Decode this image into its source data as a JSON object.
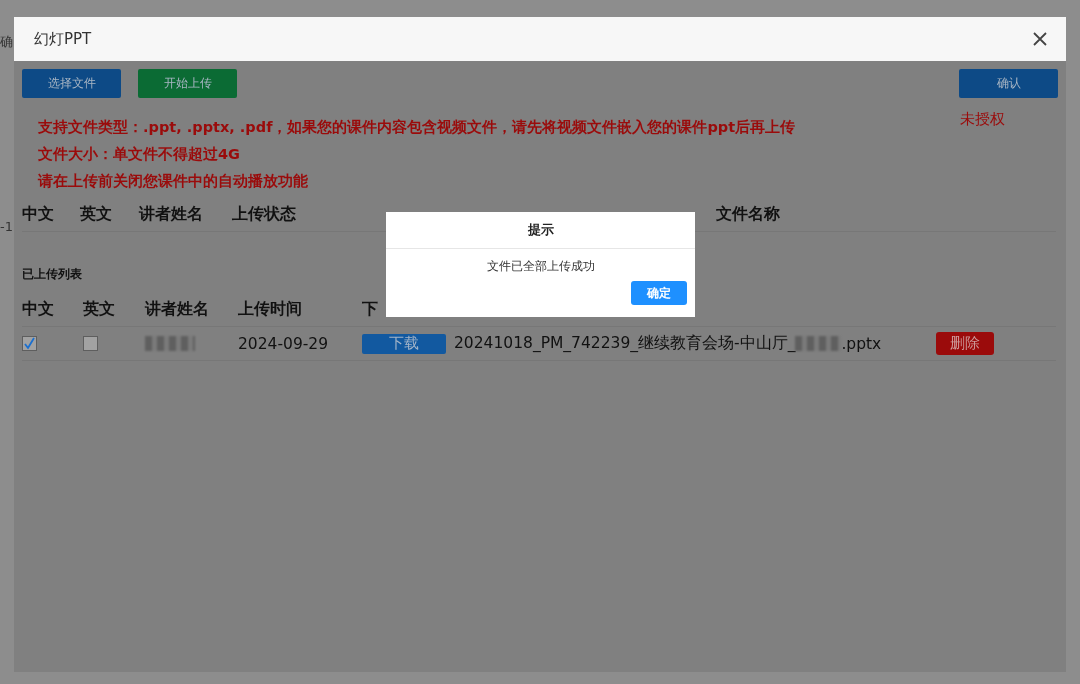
{
  "background_page": {
    "texts": [
      "确",
      "-1"
    ]
  },
  "window": {
    "title": "幻灯PPT"
  },
  "toolbar": {
    "buttons": [
      {
        "label": "选择文件",
        "kind": "primary"
      },
      {
        "label": "开始上传",
        "kind": "success"
      }
    ],
    "confirm": "确认"
  },
  "notices": [
    "支持文件类型：.ppt, .pptx, .pdf，如果您的课件内容包含视频文件，请先将视频文件嵌入您的课件ppt后再上传",
    "文件大小：单文件不得超过4G",
    "请在上传前关闭您课件中的自动播放功能"
  ],
  "auth_status": "未授权",
  "upload_table": {
    "columns": [
      "中文",
      "英文",
      "讲者姓名",
      "上传状态",
      "文件名称"
    ]
  },
  "uploaded_list": {
    "title": "已上传列表",
    "columns": [
      "中文",
      "英文",
      "讲者姓名",
      "上传时间",
      "下"
    ],
    "rows": [
      {
        "chinese_checked": true,
        "english_checked": false,
        "date": "2024-09-29",
        "download": "下载",
        "file_name_start": "20241018_PM_742239_继续教育会场-中山厅_",
        "file_name_end": ".pptx",
        "delete": "删除"
      }
    ]
  },
  "dialog": {
    "title": "提示",
    "message": "文件已全部上传成功",
    "button": "确定"
  }
}
